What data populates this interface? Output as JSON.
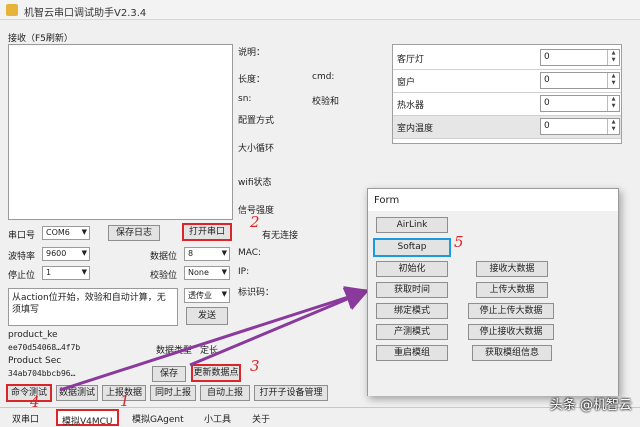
{
  "window": {
    "title": "机智云串口调试助手V2.3.4"
  },
  "receive": {
    "label": "接收（F5刷新）"
  },
  "info": {
    "desc": "说明：",
    "length": "长度：",
    "cmd": "cmd:",
    "sn": "sn:",
    "checksum": "校验和",
    "config_mode": "配置方式",
    "size_loop": "大小循环",
    "wifi_status": "wifi状态",
    "signal": "信号强度",
    "connect": "有无连接",
    "mac": "MAC:",
    "ip": "IP:",
    "ident": "标识码："
  },
  "serial": {
    "port_label": "串口号",
    "port_value": "COM6",
    "baud_label": "波特率",
    "baud_value": "9600",
    "stop_label": "停止位",
    "stop_value": "1",
    "data_label": "数据位",
    "data_value": "8",
    "parity_label": "校验位",
    "parity_value": "None",
    "save_log": "保存日志",
    "open_port": "打开串口"
  },
  "send": {
    "text": "从action位开始，效验和自动计算，无须填写",
    "mode_value": "透传业",
    "send_btn": "发送"
  },
  "product": {
    "key_label": "product_ke",
    "key_value": "ee70d54068…4f7b",
    "type_label": "数据类型",
    "fixed_label": "定长",
    "secret_label": "Product Sec",
    "secret_value": "34ab704bbcb96…"
  },
  "actions": {
    "save": "保存",
    "update_datapoint": "更新数据点",
    "cmd_test": "命令测试",
    "mock_test": "数据测试",
    "report_data": "上报数据",
    "sync_up": "同时上报",
    "auto_up": "自动上报",
    "open_device": "打开子设备管理"
  },
  "data_grid": {
    "rows": [
      {
        "name": "客厅灯",
        "value": "0"
      },
      {
        "name": "窗户",
        "value": "0"
      },
      {
        "name": "热水器",
        "value": "0"
      },
      {
        "name": "室内温度",
        "value": "0"
      }
    ]
  },
  "form": {
    "title": "Form",
    "airlink": "AirLink",
    "softap": "Softap",
    "left": [
      "初始化",
      "获取时间",
      "绑定模式",
      "产测模式",
      "重启模组"
    ],
    "right": [
      "接收大数据",
      "上传大数据",
      "停止上传大数据",
      "停止接收大数据",
      "获取模组信息"
    ]
  },
  "annotations": {
    "a1": "1",
    "a2": "2",
    "a3": "3",
    "a4": "4",
    "a5": "5"
  },
  "tabs": [
    "双串口",
    "模拟V4MCU",
    "模拟GAgent",
    "小工具",
    "关于"
  ],
  "watermark": "头条 @机智云",
  "colors": {
    "annotation_red": "#d8262b",
    "highlight_blue": "#1a9be0",
    "arrow_purple": "#8a3a9c"
  }
}
